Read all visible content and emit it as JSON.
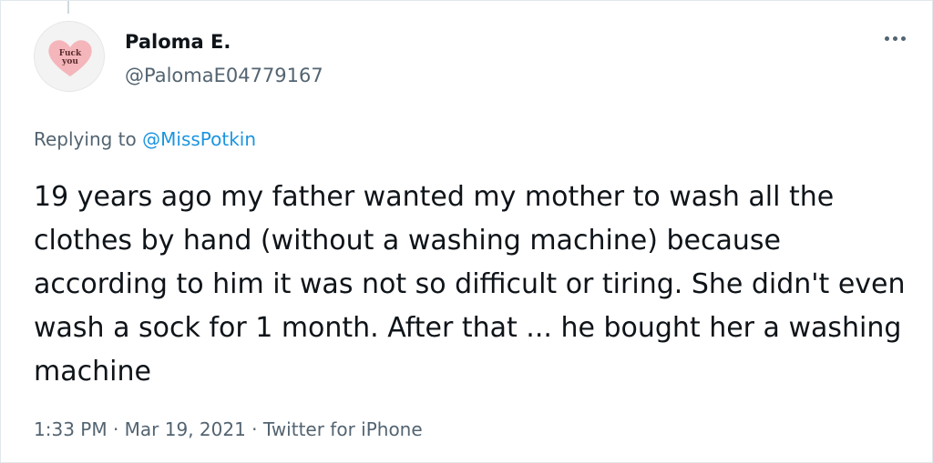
{
  "tweet": {
    "author": {
      "display_name": "Paloma E.",
      "handle": "@PalomaE04779167",
      "avatar_text_line1": "Fuck",
      "avatar_text_line2": "you"
    },
    "reply": {
      "prefix": "Replying to ",
      "mention": "@MissPotkin"
    },
    "text": "19 years ago my father wanted my mother to wash all the clothes by hand (without a washing machine) because according to him it was not so difficult or tiring. She didn't even wash a sock for 1 month. After that ... he bought her a washing machine",
    "meta": {
      "time": "1:33 PM",
      "separator": " · ",
      "date": "Mar 19, 2021",
      "source": "Twitter for iPhone"
    }
  },
  "icons": {
    "more": "more-horizontal-icon",
    "avatar_heart": "heart-icon"
  },
  "colors": {
    "text_primary": "#0f1419",
    "text_secondary": "#536471",
    "link": "#1b95e0",
    "avatar_heart": "#f4b6bb"
  }
}
